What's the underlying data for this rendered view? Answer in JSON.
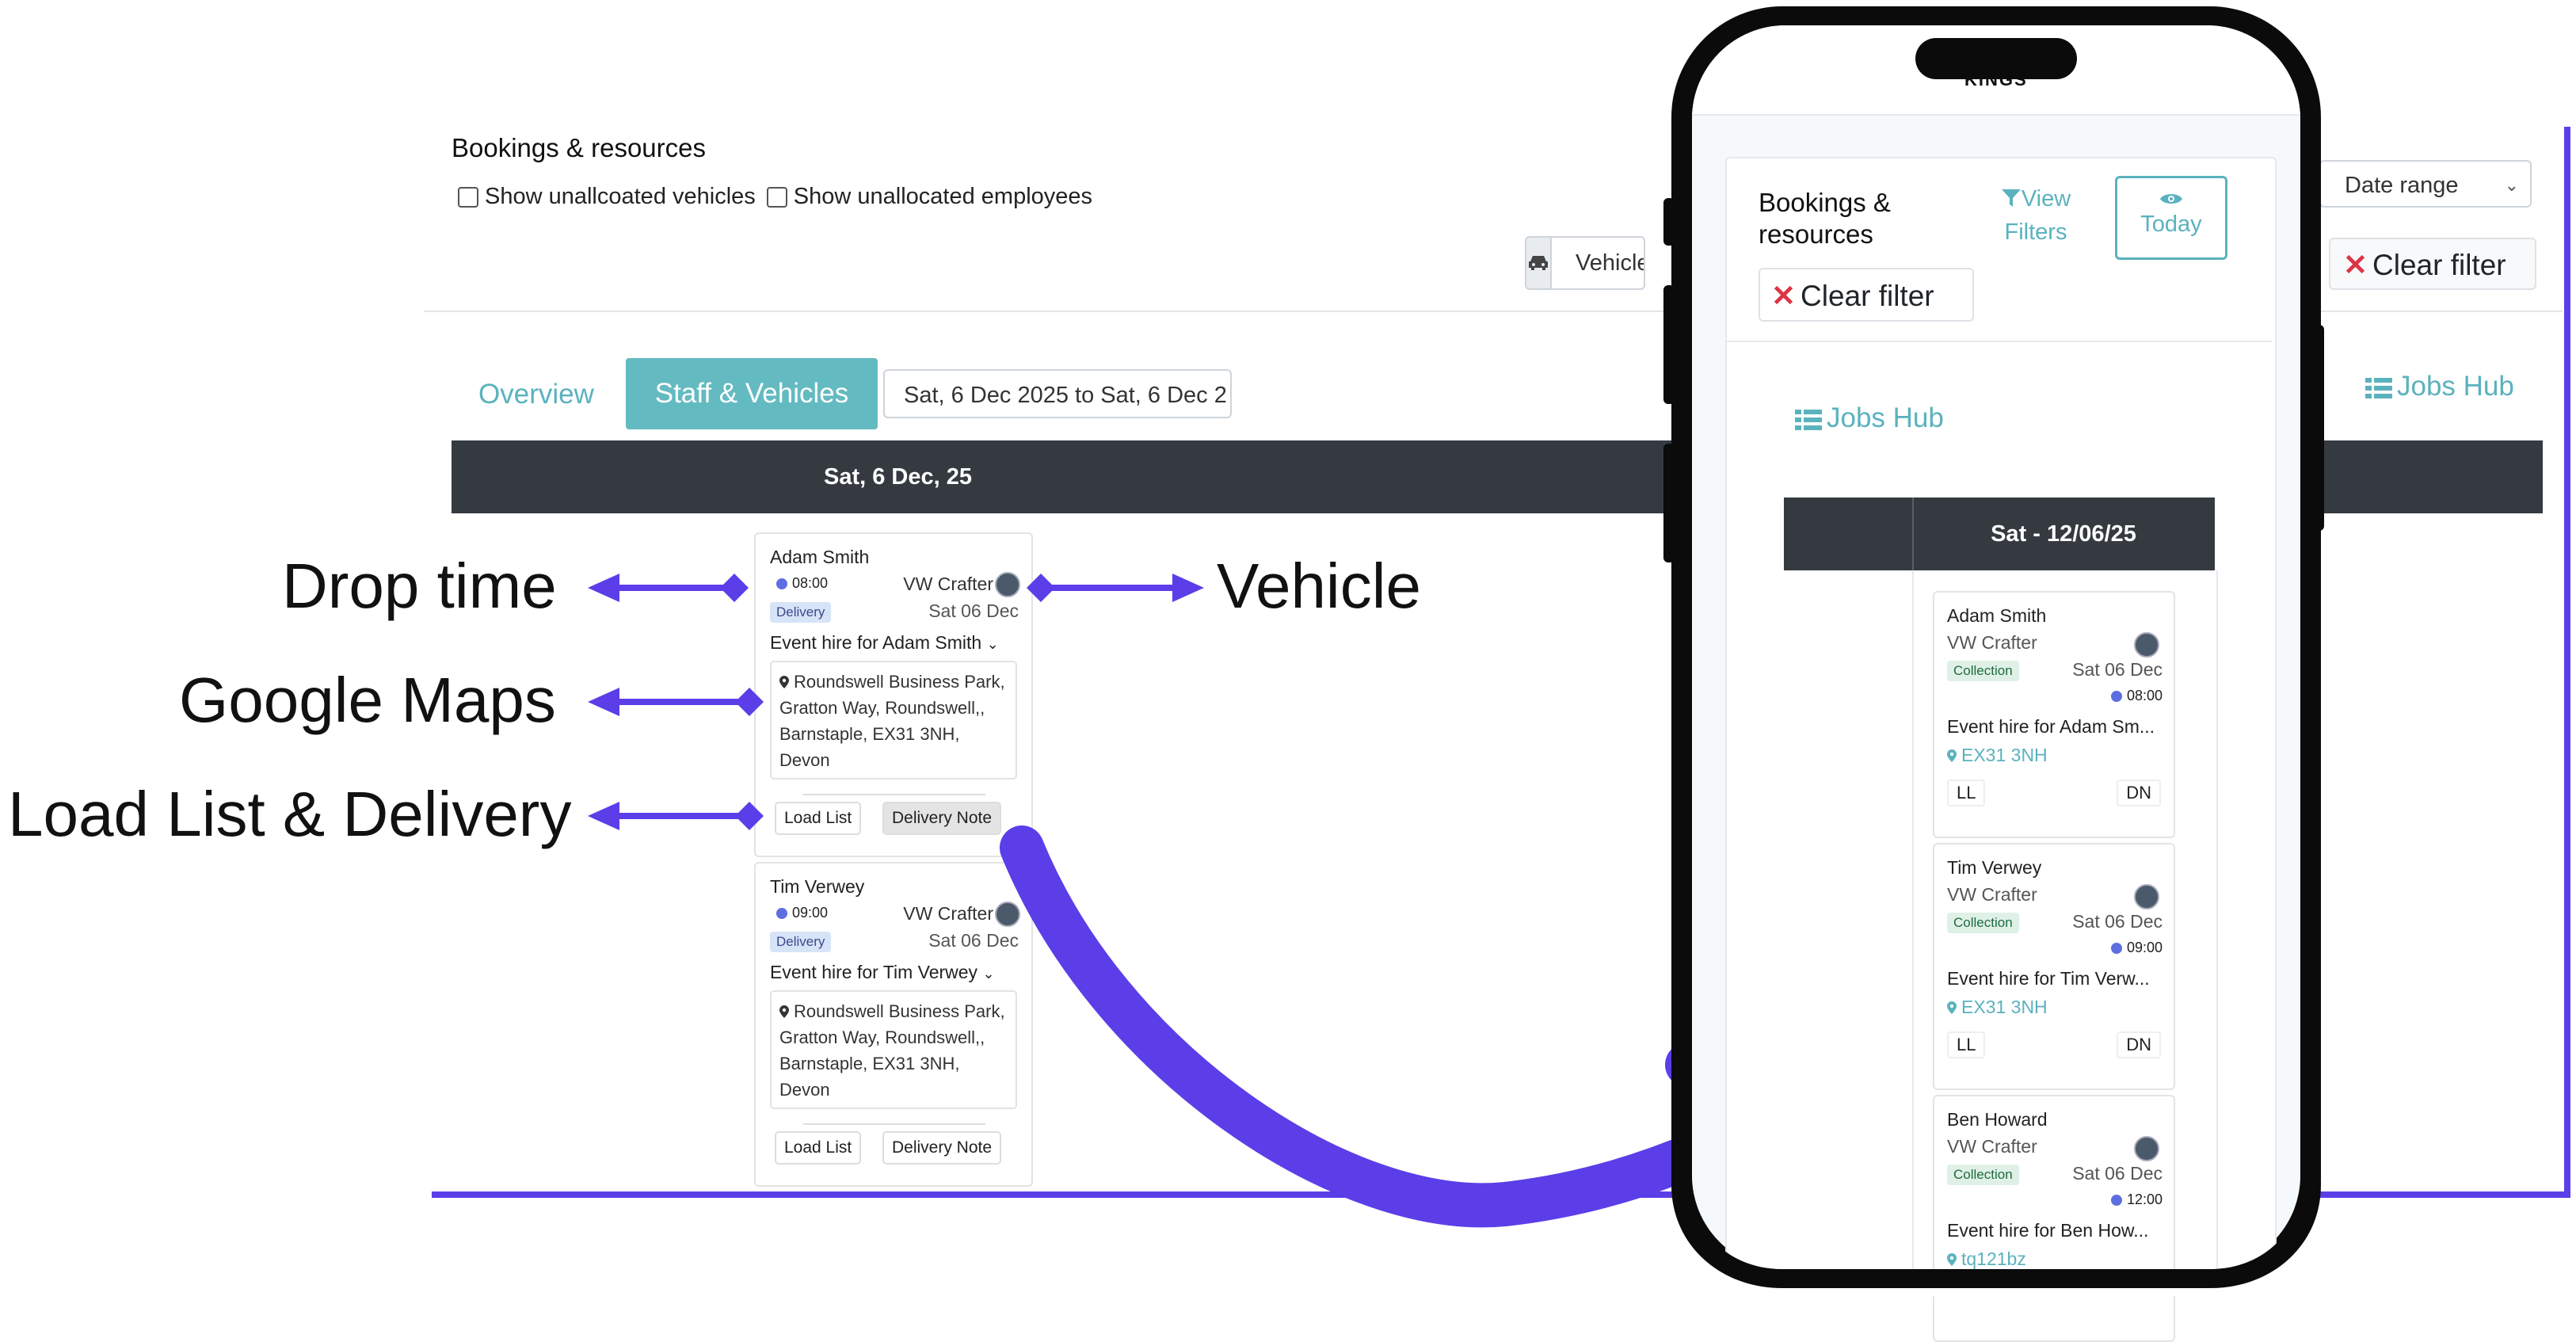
{
  "desktop": {
    "section_title": "Bookings & resources",
    "show_unallocated_vehicles": "Show unallcoated vehicles",
    "show_unallocated_employees": "Show unallocated employees",
    "vehicle_button_label": "Vehicle",
    "date_range_label": "Date range",
    "clear_filter_label": "Clear filter",
    "jobs_hub_label": "Jobs Hub",
    "tabs": [
      {
        "label": "Overview",
        "active": false
      },
      {
        "label": "Staff & Vehicles",
        "active": true
      }
    ],
    "date_input_value": "Sat, 6 Dec 2025 to Sat, 6 Dec 2",
    "day_header": "Sat, 6 Dec, 25",
    "bookings": [
      {
        "name": "Adam Smith",
        "time": "08:00",
        "vehicle": "VW Crafter",
        "badge": "Delivery",
        "date": "Sat 06 Dec",
        "event": "Event hire for Adam Smith",
        "address": [
          "Roundswell Business Park,",
          "Gratton Way, Roundswell,,",
          "Barnstaple, EX31 3NH,",
          "Devon"
        ],
        "load_list": "Load List",
        "delivery_note": "Delivery Note"
      },
      {
        "name": "Tim Verwey",
        "time": "09:00",
        "vehicle": "VW Crafter",
        "badge": "Delivery",
        "date": "Sat 06 Dec",
        "event": "Event hire for Tim Verwey",
        "address": [
          "Roundswell Business Park,",
          "Gratton Way, Roundswell,,",
          "Barnstaple, EX31 3NH,",
          "Devon"
        ],
        "load_list": "Load List",
        "delivery_note": "Delivery Note"
      }
    ]
  },
  "callouts": {
    "drop_time": "Drop time",
    "vehicle": "Vehicle",
    "google_maps": "Google Maps",
    "load_list_delivery": "Load List & Delivery"
  },
  "phone": {
    "logo_text": "KINGS",
    "title": "Bookings & resources",
    "view_filters": "View Filters",
    "today": "Today",
    "clear_filter": "Clear filter",
    "jobs_hub": "Jobs Hub",
    "day_header": "Sat - 12/06/25",
    "bookings": [
      {
        "name": "Adam Smith",
        "vehicle": "VW Crafter",
        "badge": "Collection",
        "date": "Sat 06 Dec",
        "time": "08:00",
        "event": "Event hire for Adam Sm...",
        "location": "EX31 3NH",
        "ll": "LL",
        "dn": "DN"
      },
      {
        "name": "Tim Verwey",
        "vehicle": "VW Crafter",
        "badge": "Collection",
        "date": "Sat 06 Dec",
        "time": "09:00",
        "event": "Event hire for Tim Verw...",
        "location": "EX31 3NH",
        "ll": "LL",
        "dn": "DN"
      },
      {
        "name": "Ben Howard",
        "vehicle": "VW Crafter",
        "badge": "Collection",
        "date": "Sat 06 Dec",
        "time": "12:00",
        "event": "Event hire for Ben How...",
        "location": "tq121bz",
        "ll": "",
        "dn": ""
      }
    ]
  },
  "colors": {
    "accent_teal": "#64bac1",
    "arrow_purple": "#5b3ee8",
    "dark_header": "#343a40",
    "danger_red": "#dc3545"
  }
}
